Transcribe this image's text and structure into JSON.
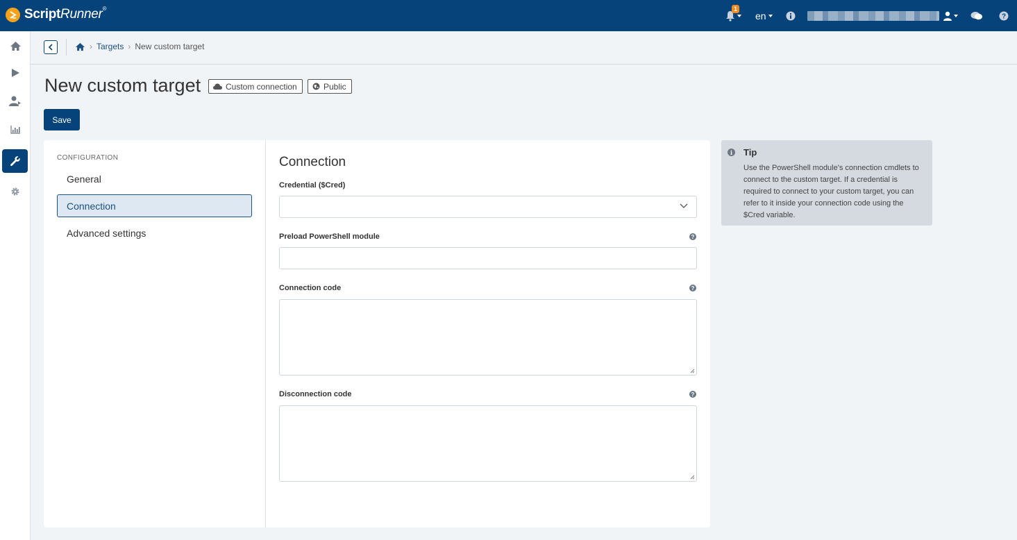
{
  "app": {
    "brand_main": "Script",
    "brand_accent": "Runner",
    "brand_reg": "®"
  },
  "topbar": {
    "notifications_count": "1",
    "language": "en",
    "icons": [
      "bell-icon",
      "info-icon",
      "user-icon",
      "chat-icon",
      "help-icon"
    ]
  },
  "sidebar": {
    "items": [
      {
        "name": "home",
        "icon": "home-icon",
        "active": false
      },
      {
        "name": "run",
        "icon": "play-icon",
        "active": false
      },
      {
        "name": "users",
        "icon": "user-icon",
        "active": false
      },
      {
        "name": "reports",
        "icon": "chart-icon",
        "active": false
      },
      {
        "name": "admin",
        "icon": "wrench-icon",
        "active": true
      },
      {
        "name": "settings",
        "icon": "gear-icon",
        "active": false
      }
    ]
  },
  "breadcrumb": {
    "home_icon": "home-icon",
    "items": [
      "Targets",
      "New custom target"
    ]
  },
  "page": {
    "title": "New custom target",
    "tags": [
      "Custom connection",
      "Public"
    ],
    "save_label": "Save"
  },
  "config": {
    "section_label": "CONFIGURATION",
    "menu": [
      "General",
      "Connection",
      "Advanced settings"
    ],
    "active_index": 1
  },
  "form": {
    "section_title": "Connection",
    "credential_label": "Credential ($Cred)",
    "credential_value": "",
    "preload_label": "Preload PowerShell module",
    "preload_value": "",
    "connection_code_label": "Connection code",
    "connection_code_value": "",
    "disconnection_code_label": "Disconnection code",
    "disconnection_code_value": ""
  },
  "tip": {
    "title": "Tip",
    "body": "Use the PowerShell module's connection cmdlets to connect to the custom target. If a credential is required to connect to your custom target, you can refer to it inside your connection code using the $Cred variable."
  },
  "colors": {
    "brand_navy": "#05437a",
    "accent_orange": "#f7a21b",
    "badge_orange": "#f28a1e"
  }
}
